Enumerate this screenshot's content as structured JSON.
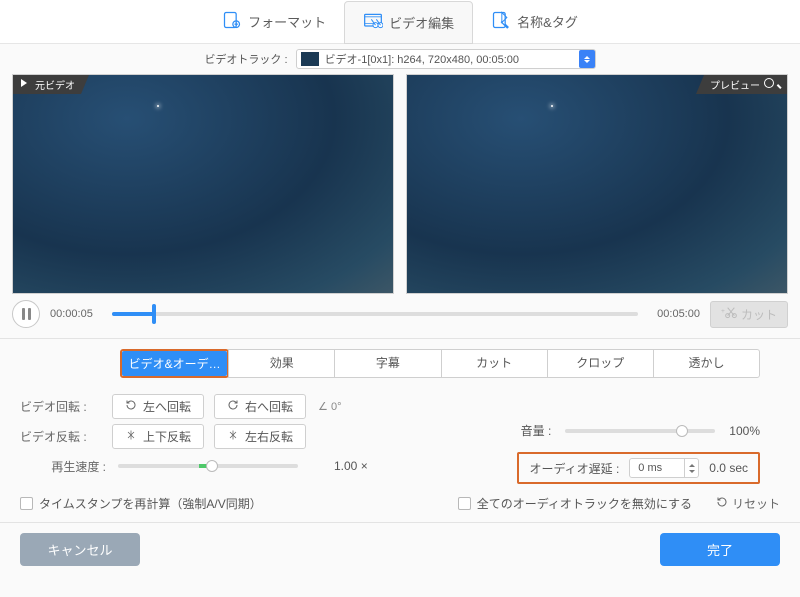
{
  "topTabs": {
    "format": "フォーマット",
    "edit": "ビデオ編集",
    "tags": "名称&タグ"
  },
  "trackRow": {
    "label": "ビデオトラック :",
    "value": "ビデオ-1[0x1]: h264, 720x480, 00:05:00"
  },
  "panes": {
    "leftLabel": "元ビデオ",
    "rightLabel": "プレビュー"
  },
  "timeline": {
    "current": "00:00:05",
    "total": "00:05:00",
    "cutLabel": "カット"
  },
  "subtabs": {
    "video_audio": "ビデオ&オーデ…",
    "effect": "効果",
    "subtitle": "字幕",
    "cut": "カット",
    "crop": "クロップ",
    "watermark": "透かし"
  },
  "rotate": {
    "label": "ビデオ回転 :",
    "left": "左へ回転",
    "right": "右へ回転",
    "angle": "∠ 0°"
  },
  "flip": {
    "label": "ビデオ反転 :",
    "vert": "上下反転",
    "horiz": "左右反転"
  },
  "speed": {
    "label": "再生速度 :",
    "value": "1.00 ×"
  },
  "volume": {
    "label": "音量 :",
    "value": "100%"
  },
  "delay": {
    "label": "オーディオ遅延 :",
    "input": "0 ms",
    "sec": "0.0 sec"
  },
  "checks": {
    "timestamp": "タイムスタンプを再計算（強制A/V同期）",
    "disableAudio": "全てのオーディオトラックを無効にする",
    "reset": "リセット"
  },
  "footer": {
    "cancel": "キャンセル",
    "done": "完了"
  }
}
